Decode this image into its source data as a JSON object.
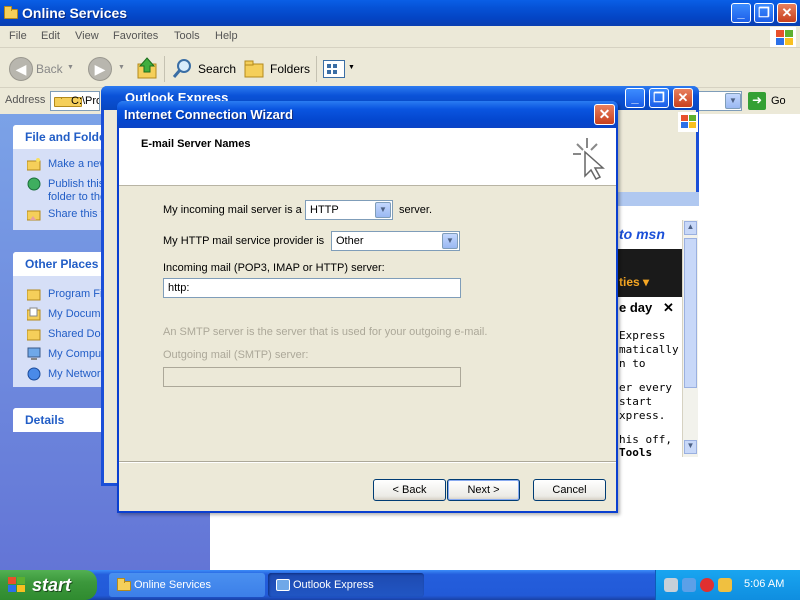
{
  "explorer": {
    "title": "Online Services",
    "menu": [
      "File",
      "Edit",
      "View",
      "Favorites",
      "Tools",
      "Help"
    ],
    "toolbar": {
      "back": "Back",
      "search": "Search",
      "folders": "Folders"
    },
    "address": {
      "label": "Address",
      "value": "C:\\Pro",
      "go": "Go"
    },
    "file_folder_tasks": {
      "heading": "File and Folder Tasks",
      "items": [
        "Make a new folder",
        "Publish this folder to the Web",
        "Share this folder"
      ]
    },
    "other_places": {
      "heading": "Other Places",
      "items": [
        "Program Files",
        "My Documents",
        "Shared Documents",
        "My Computer",
        "My Network Places"
      ]
    },
    "details": {
      "heading": "Details"
    }
  },
  "outlook": {
    "title": "Outlook Express",
    "msn": "to msn",
    "ties": "ties ▾",
    "day": "e day",
    "body_lines": [
      "Express",
      "matically",
      "n to",
      "er every",
      "start",
      "xpress.",
      "his off,",
      "Tools"
    ]
  },
  "wizard": {
    "title": "Internet Connection Wizard",
    "header": "E-mail Server Names",
    "incoming_type_label": "My incoming mail server is a",
    "incoming_type_value": "HTTP",
    "incoming_type_suffix": "server.",
    "provider_label": "My HTTP mail service provider is",
    "provider_value": "Other",
    "incoming_server_label": "Incoming mail (POP3, IMAP or HTTP) server:",
    "incoming_server_value": "http:",
    "smtp_info": "An SMTP server is the server that is used for your outgoing e-mail.",
    "outgoing_label": "Outgoing mail (SMTP) server:",
    "outgoing_value": "",
    "buttons": {
      "back": "< Back",
      "next": "Next >",
      "cancel": "Cancel"
    }
  },
  "taskbar": {
    "start": "start",
    "items": [
      "Online Services",
      "Outlook Express"
    ],
    "clock": "5:06 AM"
  },
  "colors": {
    "title_blue": "#0a52d8",
    "panel_blue": "#215dc6",
    "dialog_face": "#ece9d8",
    "start_green": "#3c983c"
  }
}
